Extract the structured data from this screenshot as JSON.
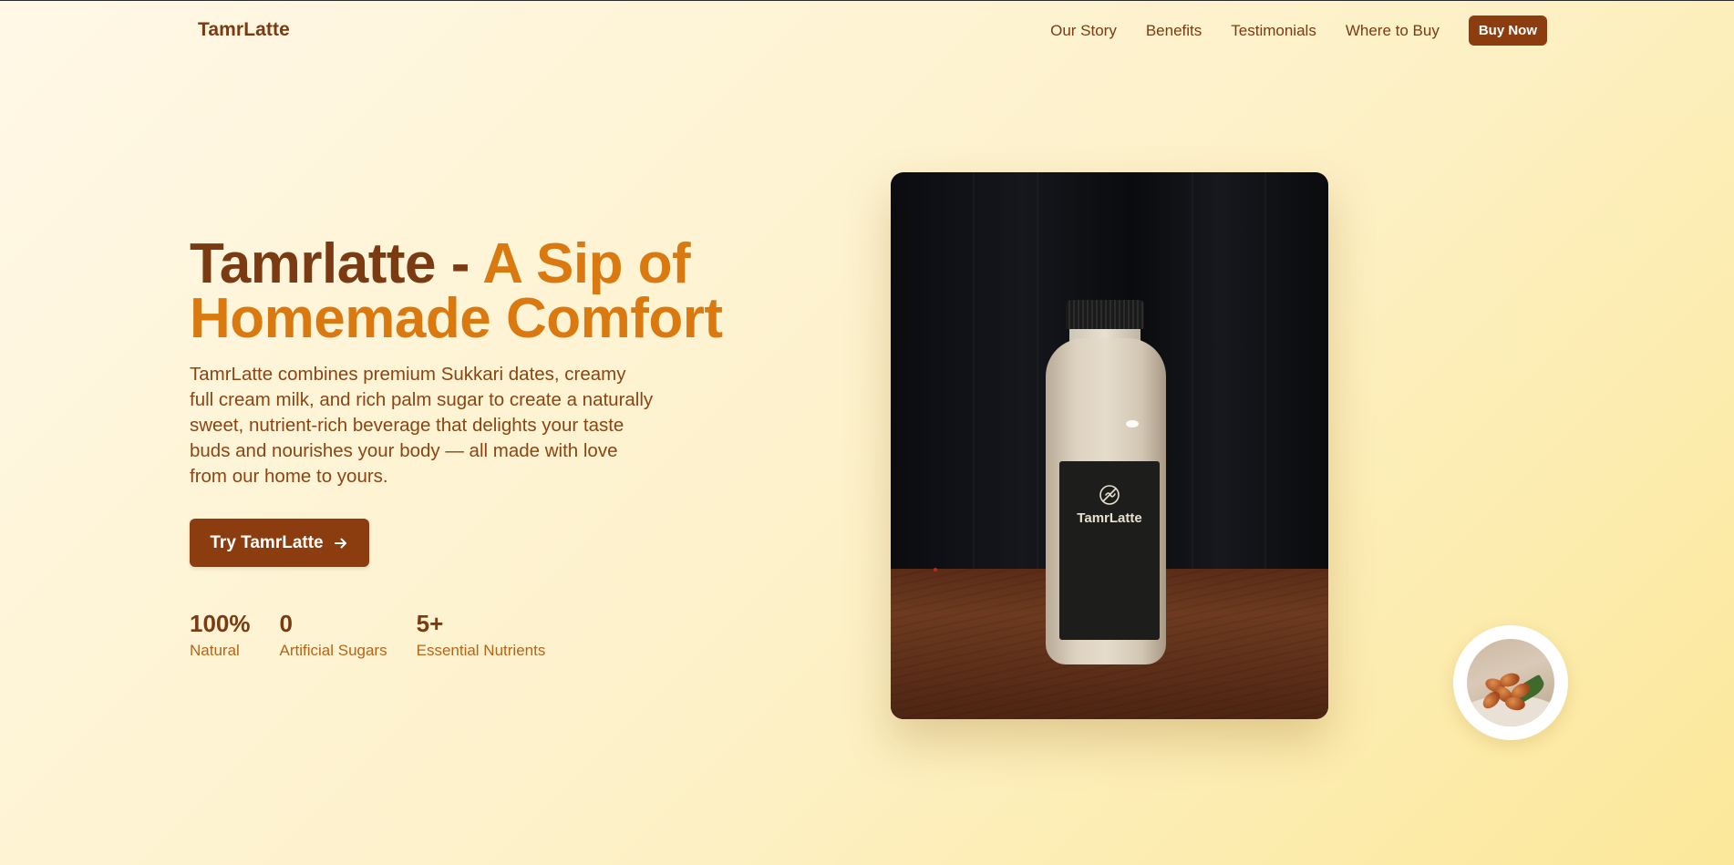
{
  "nav": {
    "brand": "TamrLatte",
    "links": [
      "Our Story",
      "Benefits",
      "Testimonials",
      "Where to Buy"
    ],
    "cta": "Buy Now"
  },
  "hero": {
    "title_part1": "Tamrlatte - ",
    "title_part2": "A Sip of Homemade Comfort",
    "description": "TamrLatte combines premium Sukkari dates, creamy full cream milk, and rich palm sugar to create a naturally sweet, nutrient-rich beverage that delights your taste buds and nourishes your body — all made with love from our home to yours.",
    "cta": "Try TamrLatte",
    "stats": [
      {
        "value": "100%",
        "label": "Natural"
      },
      {
        "value": "0",
        "label": "Artificial Sugars"
      },
      {
        "value": "5+",
        "label": "Essential Nutrients"
      }
    ]
  },
  "bottle_label": {
    "brand": "TamrLatte"
  },
  "colors": {
    "brand_brown": "#8b3d10",
    "accent_orange": "#d9790f",
    "text_brown": "#7a3a12"
  }
}
